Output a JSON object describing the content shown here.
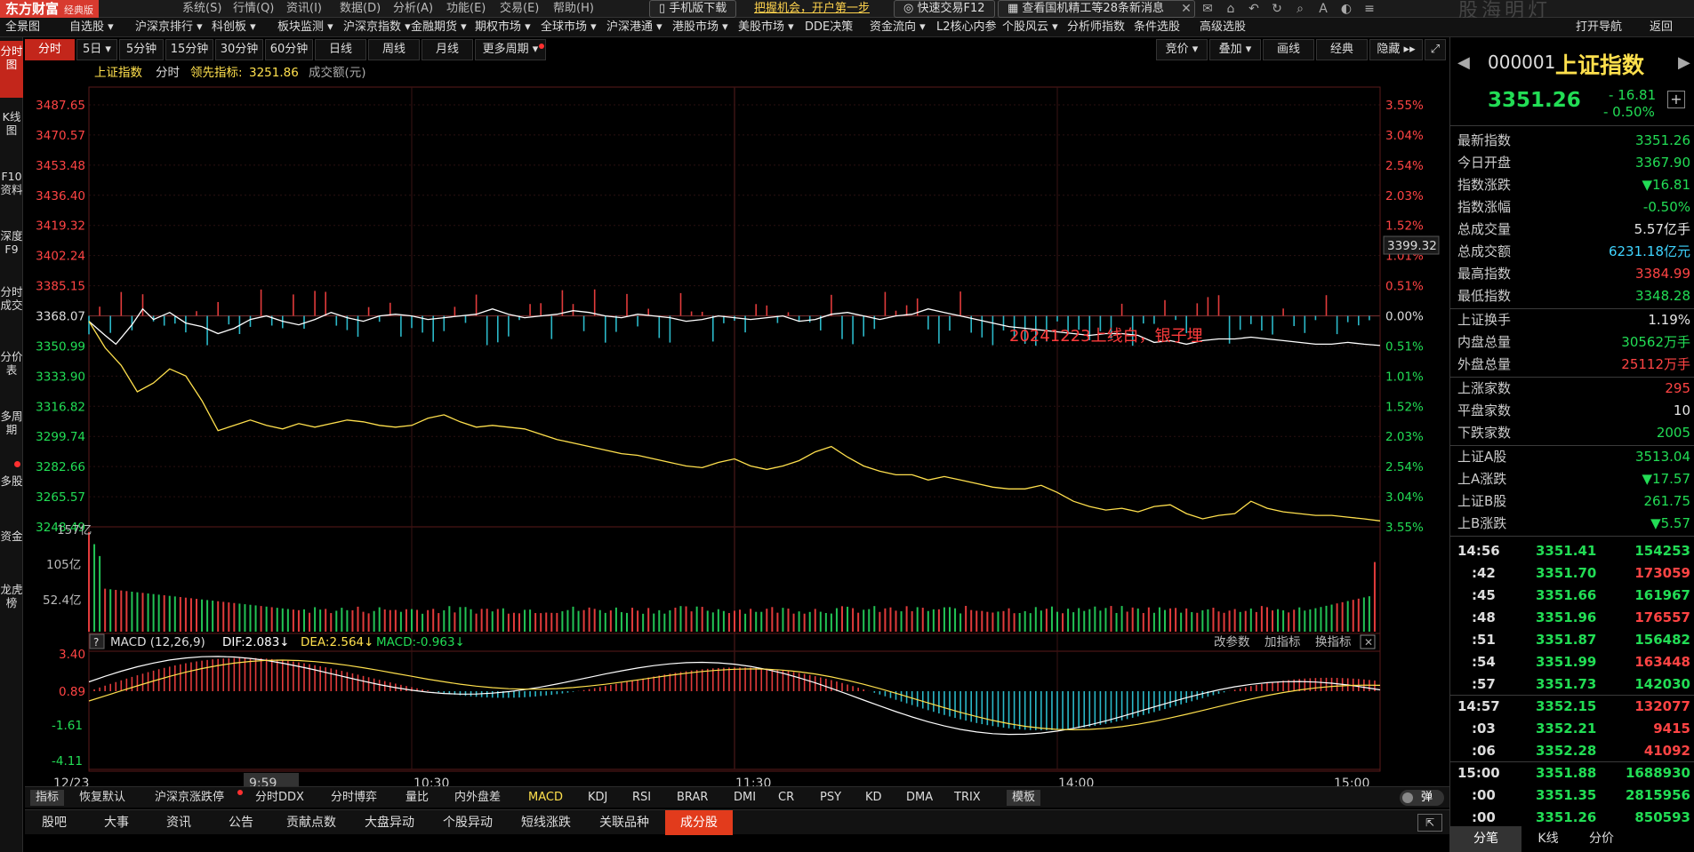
{
  "app": {
    "logo": "东方财富",
    "edition": "经典版",
    "menus": [
      "系统(S)",
      "行情(Q)",
      "资讯(I)",
      "数据(D)",
      "分析(A)",
      "功能(E)",
      "交易(E)",
      "帮助(H)"
    ],
    "mobile_download": "手机版下载",
    "promo_link": "把握机会，开户第一步",
    "quick_trade": "快速交易F12",
    "news_ticker": "查看国机精工等28条新消息",
    "watermark": "股海明灯"
  },
  "main_nav": [
    "全景图",
    "自选股 ▾",
    "沪深京排行 ▾",
    "科创板 ▾",
    "板块监测 ▾",
    "沪深京指数 ▾",
    "金融期货 ▾",
    "期权市场 ▾",
    "全球市场 ▾",
    "沪深港通 ▾",
    "港股市场 ▾",
    "美股市场 ▾",
    "DDE决策",
    "资金流向 ▾",
    "L2核心内参",
    "个股风云 ▾",
    "分析师指数",
    "条件选股",
    "高级选股",
    "打开导航",
    "返回"
  ],
  "left_tabs": [
    "分时图",
    "K线图",
    "F10资料",
    "深度F9",
    "分时成交",
    "分价表",
    "多周期",
    "多股",
    "资金",
    "龙虎榜"
  ],
  "period_tabs": [
    "分时",
    "5日 ▾",
    "5分钟",
    "15分钟",
    "30分钟",
    "60分钟",
    "日线",
    "周线",
    "月线",
    "更多周期 ▾"
  ],
  "chart_tools": [
    "竞价 ▾",
    "叠加 ▾",
    "画线",
    "经典",
    "隐藏 ▸▸"
  ],
  "chart_header": {
    "name": "上证指数",
    "mode": "分时",
    "lead_label": "领先指标:",
    "lead_value": "3251.86",
    "amount_label": "成交额(元)"
  },
  "annotation": "20241223上线白，银子埋",
  "price_label_right": "3399.32",
  "vol_axis": [
    "157亿",
    "105亿",
    "52.4亿"
  ],
  "macd_header": {
    "name": "MACD (12,26,9)",
    "dif": "DIF:2.083↓",
    "dea": "DEA:2.564↓",
    "macd": "MACD:-0.963↓",
    "actions": [
      "改参数",
      "加指标",
      "换指标"
    ]
  },
  "macd_axis": [
    "3.40",
    "0.89",
    "-1.61",
    "-4.11"
  ],
  "time_axis": [
    "12/23",
    "9:59",
    "10:30",
    "11:30",
    "14:00",
    "15:00"
  ],
  "chart_data": {
    "type": "line",
    "title": "上证指数 分时",
    "x_range": [
      "09:30",
      "15:00"
    ],
    "pre_close": 3368.07,
    "y_ticks_left": [
      "3487.65",
      "3470.57",
      "3453.48",
      "3436.40",
      "3419.32",
      "3402.24",
      "3385.15",
      "3368.07",
      "3350.99",
      "3333.90",
      "3316.82",
      "3299.74",
      "3282.66",
      "3265.57",
      "3248.49"
    ],
    "y_ticks_right": [
      "3.55%",
      "3.04%",
      "2.54%",
      "2.03%",
      "1.52%",
      "1.01%",
      "0.51%",
      "0.00%",
      "0.51%",
      "1.01%",
      "1.52%",
      "2.03%",
      "2.54%",
      "3.04%",
      "3.55%"
    ],
    "ylim": [
      3248.49,
      3487.65
    ],
    "grid": true,
    "series": [
      {
        "name": "上证指数",
        "color": "#ffffff",
        "points": [
          [
            0,
            3365
          ],
          [
            3,
            3357
          ],
          [
            5,
            3352
          ],
          [
            8,
            3363
          ],
          [
            10,
            3372
          ],
          [
            12,
            3366
          ],
          [
            15,
            3370
          ],
          [
            18,
            3364
          ],
          [
            21,
            3362
          ],
          [
            24,
            3358
          ],
          [
            27,
            3361
          ],
          [
            30,
            3366
          ],
          [
            33,
            3368
          ],
          [
            36,
            3365
          ],
          [
            39,
            3363
          ],
          [
            42,
            3366
          ],
          [
            45,
            3370
          ],
          [
            48,
            3367
          ],
          [
            51,
            3365
          ],
          [
            54,
            3368
          ],
          [
            57,
            3369
          ],
          [
            60,
            3368
          ],
          [
            63,
            3366
          ],
          [
            66,
            3367
          ],
          [
            69,
            3368
          ],
          [
            72,
            3369
          ],
          [
            75,
            3372
          ],
          [
            78,
            3369
          ],
          [
            81,
            3367
          ],
          [
            84,
            3368
          ],
          [
            87,
            3369
          ],
          [
            90,
            3371
          ],
          [
            93,
            3370
          ],
          [
            96,
            3368
          ],
          [
            99,
            3367
          ],
          [
            102,
            3369
          ],
          [
            105,
            3368
          ],
          [
            108,
            3367
          ],
          [
            111,
            3365
          ],
          [
            114,
            3366
          ],
          [
            117,
            3368
          ],
          [
            120,
            3367
          ],
          [
            123,
            3366
          ],
          [
            126,
            3367
          ],
          [
            129,
            3368
          ],
          [
            132,
            3365
          ],
          [
            135,
            3366
          ],
          [
            138,
            3369
          ],
          [
            141,
            3370
          ],
          [
            144,
            3368
          ],
          [
            147,
            3366
          ],
          [
            150,
            3368
          ],
          [
            153,
            3369
          ],
          [
            156,
            3372
          ],
          [
            159,
            3370
          ],
          [
            162,
            3368
          ],
          [
            165,
            3366
          ],
          [
            168,
            3364
          ],
          [
            171,
            3362
          ],
          [
            174,
            3361
          ],
          [
            177,
            3360
          ],
          [
            180,
            3359
          ],
          [
            183,
            3358
          ],
          [
            186,
            3357
          ],
          [
            189,
            3358
          ],
          [
            192,
            3358
          ],
          [
            195,
            3357
          ],
          [
            198,
            3353
          ],
          [
            201,
            3354
          ],
          [
            204,
            3352
          ],
          [
            207,
            3354
          ],
          [
            210,
            3355
          ],
          [
            213,
            3355
          ],
          [
            216,
            3356
          ],
          [
            219,
            3355
          ],
          [
            222,
            3354
          ],
          [
            225,
            3353
          ],
          [
            228,
            3352
          ],
          [
            231,
            3352
          ],
          [
            234,
            3353
          ],
          [
            237,
            3352
          ],
          [
            240,
            3351.26
          ]
        ]
      },
      {
        "name": "领先指标",
        "color": "#ffe04d",
        "points": [
          [
            0,
            3365
          ],
          [
            3,
            3350
          ],
          [
            6,
            3340
          ],
          [
            9,
            3325
          ],
          [
            12,
            3330
          ],
          [
            15,
            3338
          ],
          [
            18,
            3334
          ],
          [
            21,
            3320
          ],
          [
            24,
            3303
          ],
          [
            27,
            3306
          ],
          [
            30,
            3309
          ],
          [
            33,
            3306
          ],
          [
            36,
            3304
          ],
          [
            39,
            3307
          ],
          [
            42,
            3305
          ],
          [
            45,
            3307
          ],
          [
            48,
            3309
          ],
          [
            51,
            3308
          ],
          [
            54,
            3306
          ],
          [
            57,
            3305
          ],
          [
            60,
            3306
          ],
          [
            63,
            3310
          ],
          [
            66,
            3312
          ],
          [
            69,
            3308
          ],
          [
            72,
            3305
          ],
          [
            75,
            3306
          ],
          [
            78,
            3305
          ],
          [
            81,
            3304
          ],
          [
            84,
            3301
          ],
          [
            87,
            3298
          ],
          [
            90,
            3296
          ],
          [
            93,
            3294
          ],
          [
            96,
            3292
          ],
          [
            99,
            3290
          ],
          [
            102,
            3289
          ],
          [
            105,
            3287
          ],
          [
            108,
            3285
          ],
          [
            111,
            3283
          ],
          [
            114,
            3282
          ],
          [
            117,
            3285
          ],
          [
            120,
            3287
          ],
          [
            123,
            3283
          ],
          [
            126,
            3281
          ],
          [
            129,
            3283
          ],
          [
            132,
            3286
          ],
          [
            135,
            3291
          ],
          [
            138,
            3294
          ],
          [
            141,
            3288
          ],
          [
            144,
            3283
          ],
          [
            147,
            3280
          ],
          [
            150,
            3278
          ],
          [
            153,
            3278
          ],
          [
            156,
            3275
          ],
          [
            159,
            3277
          ],
          [
            162,
            3275
          ],
          [
            165,
            3273
          ],
          [
            168,
            3271
          ],
          [
            171,
            3270
          ],
          [
            174,
            3270
          ],
          [
            177,
            3272
          ],
          [
            180,
            3268
          ],
          [
            183,
            3263
          ],
          [
            186,
            3260
          ],
          [
            189,
            3258
          ],
          [
            192,
            3259
          ],
          [
            195,
            3257
          ],
          [
            198,
            3260
          ],
          [
            201,
            3261
          ],
          [
            204,
            3256
          ],
          [
            207,
            3253
          ],
          [
            210,
            3255
          ],
          [
            213,
            3256
          ],
          [
            216,
            3263
          ],
          [
            219,
            3259
          ],
          [
            222,
            3257
          ],
          [
            225,
            3256
          ],
          [
            228,
            3255
          ],
          [
            231,
            3255
          ],
          [
            234,
            3254
          ],
          [
            237,
            3253
          ],
          [
            240,
            3251.86
          ]
        ]
      }
    ]
  },
  "right_panel": {
    "code": "000001",
    "name": "上证指数",
    "price": "3351.26",
    "change": "- 16.81",
    "change_pct": "- 0.50%",
    "stats": [
      {
        "k": "最新指数",
        "v": "3351.26",
        "c": "green"
      },
      {
        "k": "今日开盘",
        "v": "3367.90",
        "c": "green"
      },
      {
        "k": "指数涨跌",
        "v": "▼16.81",
        "c": "green"
      },
      {
        "k": "指数涨幅",
        "v": "-0.50%",
        "c": "green"
      },
      {
        "k": "总成交量",
        "v": "5.57亿手",
        "c": "white"
      },
      {
        "k": "总成交额",
        "v": "6231.18亿元",
        "c": "cyan"
      },
      {
        "k": "最高指数",
        "v": "3384.99",
        "c": "red"
      },
      {
        "k": "最低指数",
        "v": "3348.28",
        "c": "green"
      }
    ],
    "stats2": [
      {
        "k": "上证换手",
        "v": "1.19%",
        "c": "white"
      },
      {
        "k": "内盘总量",
        "v": "30562万手",
        "c": "green"
      },
      {
        "k": "外盘总量",
        "v": "25112万手",
        "c": "red"
      }
    ],
    "stats3": [
      {
        "k": "上涨家数",
        "v": "295",
        "c": "red"
      },
      {
        "k": "平盘家数",
        "v": "10",
        "c": "white"
      },
      {
        "k": "下跌家数",
        "v": "2005",
        "c": "green"
      }
    ],
    "stats4": [
      {
        "k": "上证A股",
        "v": "3513.04",
        "c": "green"
      },
      {
        "k": "上A涨跌",
        "v": "▼17.57",
        "c": "green"
      },
      {
        "k": "上证B股",
        "v": "261.75",
        "c": "green"
      },
      {
        "k": "上B涨跌",
        "v": "▼5.57",
        "c": "green"
      }
    ],
    "ticks": [
      {
        "t": "14:56",
        "p": "3351.41",
        "v": "154253",
        "c": "green"
      },
      {
        "t": ":42",
        "p": "3351.70",
        "v": "173059",
        "c": "red"
      },
      {
        "t": ":45",
        "p": "3351.66",
        "v": "161967",
        "c": "green"
      },
      {
        "t": ":48",
        "p": "3351.96",
        "v": "176557",
        "c": "red"
      },
      {
        "t": ":51",
        "p": "3351.87",
        "v": "156482",
        "c": "green"
      },
      {
        "t": ":54",
        "p": "3351.99",
        "v": "163448",
        "c": "red"
      },
      {
        "t": ":57",
        "p": "3351.73",
        "v": "142030",
        "c": "green"
      },
      {
        "t": "14:57",
        "p": "3352.15",
        "v": "132077",
        "c": "red"
      },
      {
        "t": ":03",
        "p": "3352.21",
        "v": "9415",
        "c": "red"
      },
      {
        "t": ":06",
        "p": "3352.28",
        "v": "41092",
        "c": "red"
      },
      {
        "t": "15:00",
        "p": "3351.88",
        "v": "1688930",
        "c": "green"
      },
      {
        "t": ":00",
        "p": "3351.35",
        "v": "2815956",
        "c": "green"
      },
      {
        "t": ":00",
        "p": "3351.26",
        "v": "850593",
        "c": "green"
      }
    ],
    "bottom_tabs": [
      "分笔",
      "K线",
      "分价"
    ]
  },
  "indicator_tabs": [
    "指标",
    "恢复默认",
    "沪深京涨跌停",
    "分时DDX",
    "分时博弈",
    "量比",
    "内外盘差",
    "MACD",
    "KDJ",
    "RSI",
    "BRAR",
    "DMI",
    "CR",
    "PSY",
    "KD",
    "DMA",
    "TRIX",
    "模板"
  ],
  "toggle_label": "弹",
  "news_tabs": [
    "股吧",
    "大事",
    "资讯",
    "公告",
    "贡献点数",
    "大盘异动",
    "个股异动",
    "短线涨跌",
    "关联品种",
    "成分股"
  ]
}
